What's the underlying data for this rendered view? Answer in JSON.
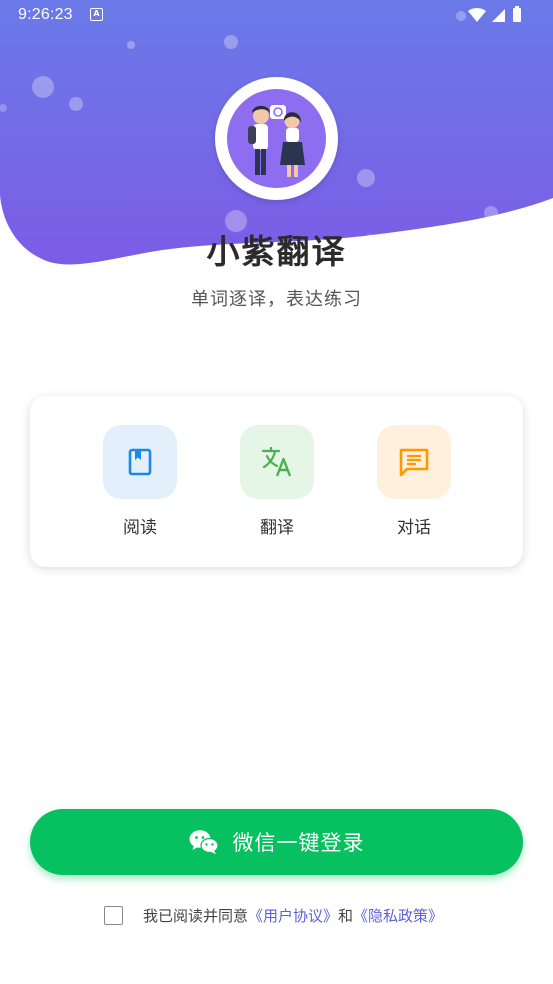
{
  "status_bar": {
    "time": "9:26:23",
    "app_icon_letter": "A",
    "icons": [
      "wifi-icon",
      "signal-icon",
      "battery-icon"
    ]
  },
  "header": {
    "title": "小紫翻译",
    "slogan": "单词逐译，表达练习",
    "bg_colors": [
      "#6a7ae8",
      "#7c5ce6"
    ]
  },
  "features": [
    {
      "label": "阅读",
      "icon": "book-icon",
      "bg": "#e3f0fc",
      "color": "#1e88e5"
    },
    {
      "label": "翻译",
      "icon": "translate-icon",
      "bg": "#e5f5e6",
      "color": "#4caf50"
    },
    {
      "label": "对话",
      "icon": "chat-icon",
      "bg": "#fff0de",
      "color": "#ff9800"
    }
  ],
  "login": {
    "label": "微信一键登录",
    "color": "#07c160"
  },
  "agreement": {
    "checked": false,
    "prefix": "我已阅读并同意",
    "user_agreement": "《用户协议》",
    "and": "和",
    "privacy_policy": "《隐私政策》"
  }
}
